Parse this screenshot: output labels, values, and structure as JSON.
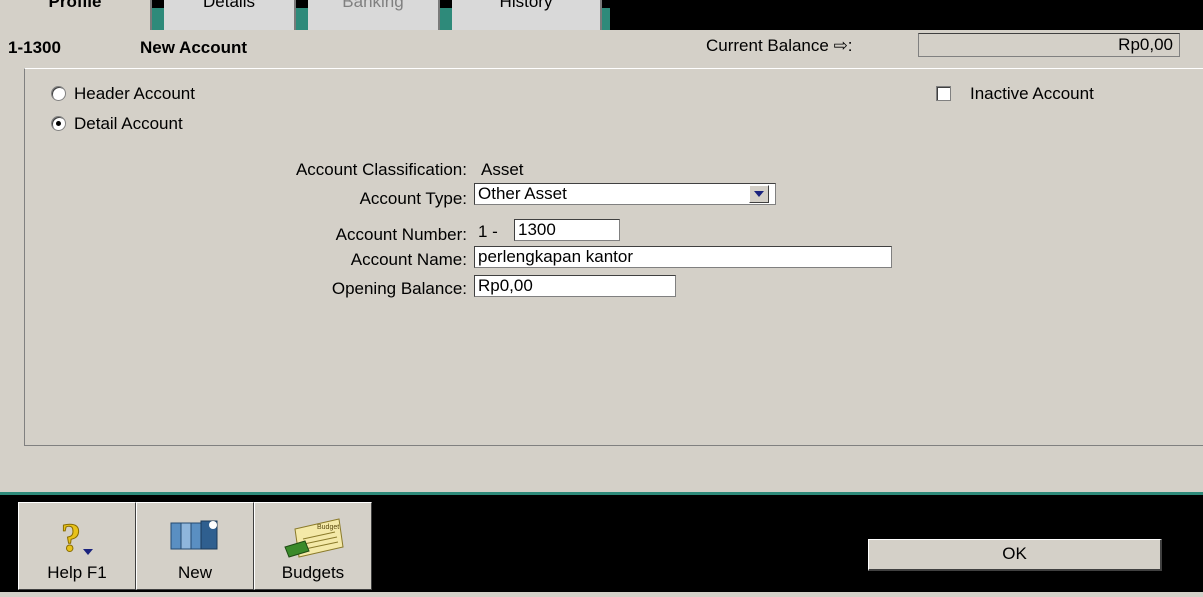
{
  "tabs": {
    "profile": "Profile",
    "details": "Details",
    "banking": "Banking",
    "history": "History"
  },
  "header": {
    "account_id": "1-1300",
    "account_title": "New Account",
    "current_balance_label": "Current Balance ⇨:",
    "current_balance_value": "Rp0,00"
  },
  "account_kind": {
    "header_label": "Header Account",
    "detail_label": "Detail Account",
    "selected": "detail",
    "inactive_label": "Inactive Account",
    "inactive_checked": false
  },
  "form": {
    "classification_label": "Account Classification:",
    "classification_value": "Asset",
    "type_label": "Account Type:",
    "type_value": "Other Asset",
    "number_label": "Account Number:",
    "number_prefix": "1 -",
    "number_value": "1300",
    "name_label": "Account Name:",
    "name_value": "perlengkapan kantor",
    "opening_label": "Opening Balance:",
    "opening_value": "Rp0,00"
  },
  "toolbar": {
    "help_label": "Help F1",
    "new_label": "New",
    "budgets_label": "Budgets",
    "budget_icon_text": "Budget",
    "ok_label": "OK"
  },
  "colors": {
    "window_bg": "#d4d0c8",
    "accent_teal": "#2e8a7a",
    "dropdown_arrow": "#1a237e"
  }
}
